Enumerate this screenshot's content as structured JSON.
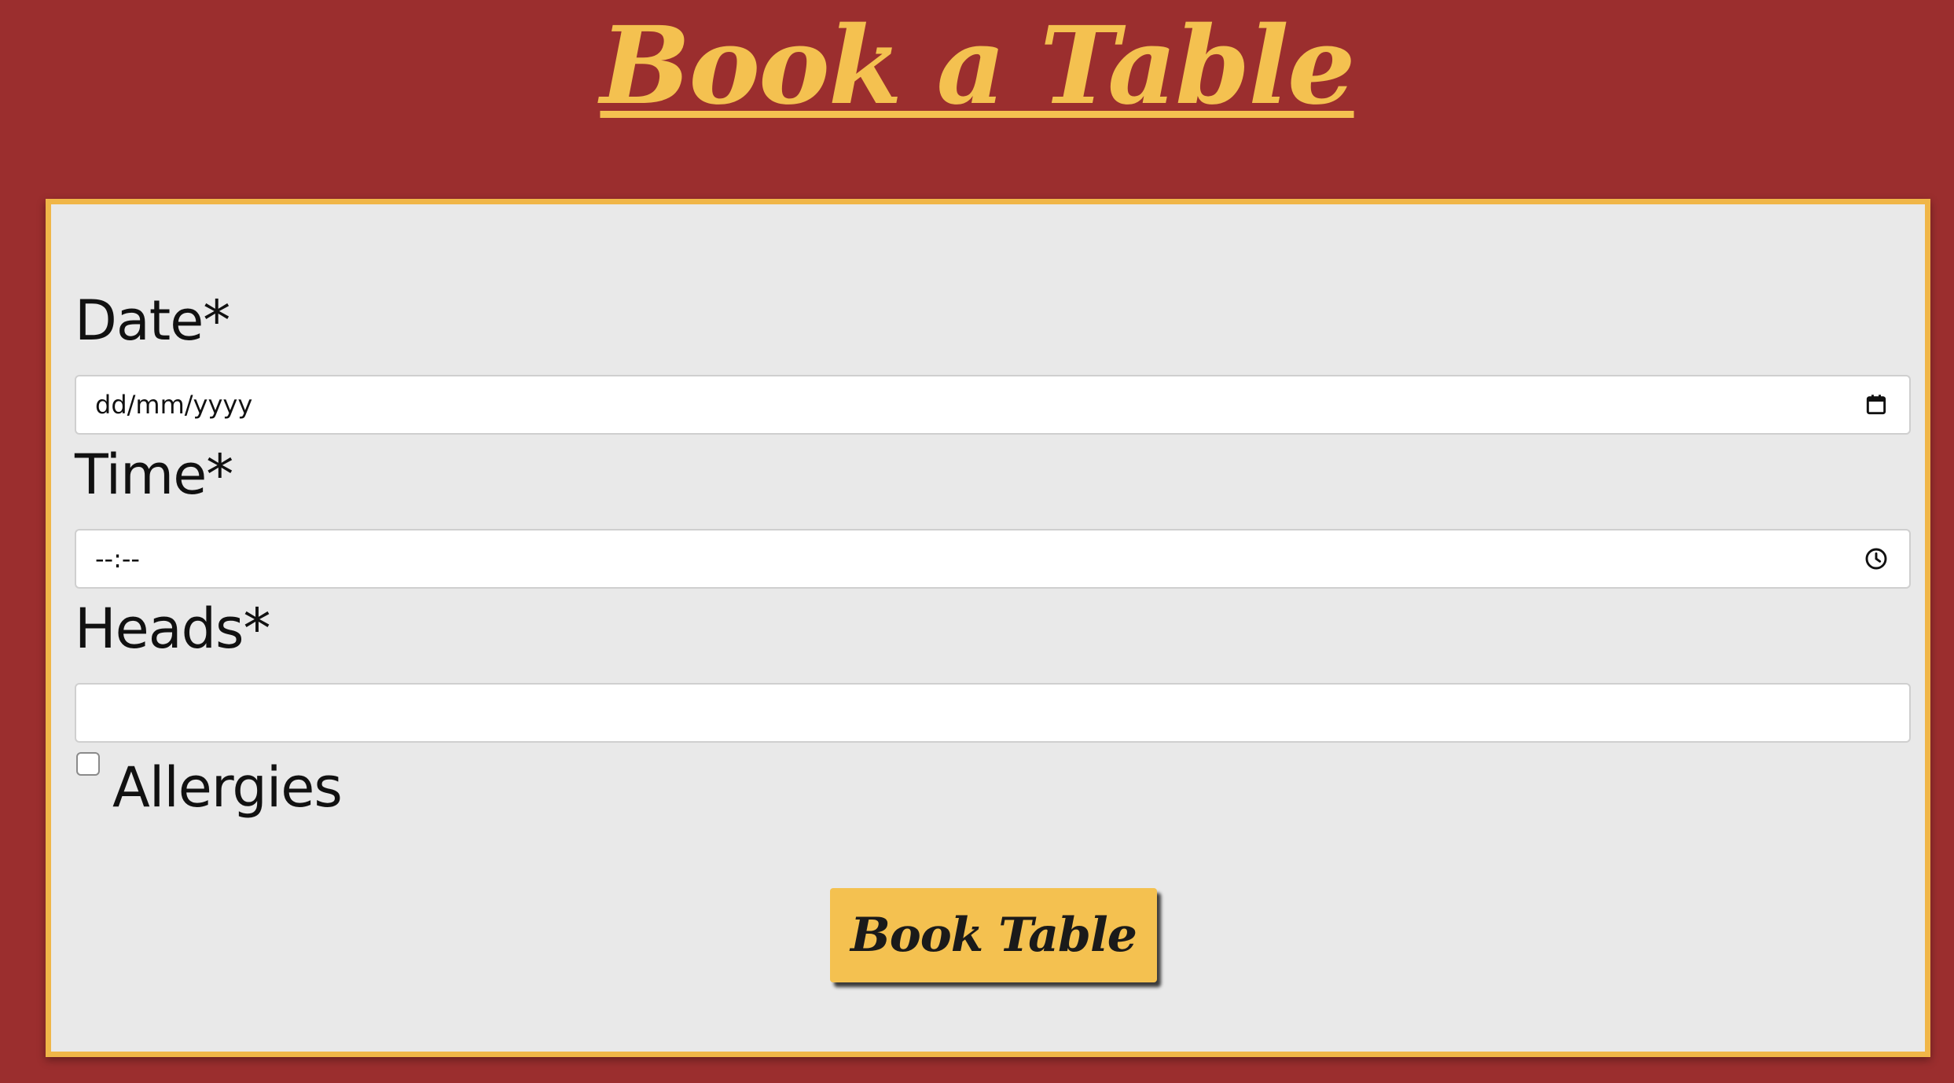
{
  "header": {
    "title": "Book a Table"
  },
  "form": {
    "date": {
      "label": "Date*",
      "value": "dd/mm/yyyy",
      "icon": "calendar-icon"
    },
    "time": {
      "label": "Time*",
      "value": "--:--",
      "icon": "clock-icon"
    },
    "heads": {
      "label": "Heads*",
      "value": ""
    },
    "allergies": {
      "label": "Allergies",
      "checked": false
    },
    "submit_label": "Book Table"
  },
  "colors": {
    "background": "#9b2e2e",
    "accent": "#f4c150",
    "card": "#e9e9e9",
    "card_border": "#f0b648"
  }
}
